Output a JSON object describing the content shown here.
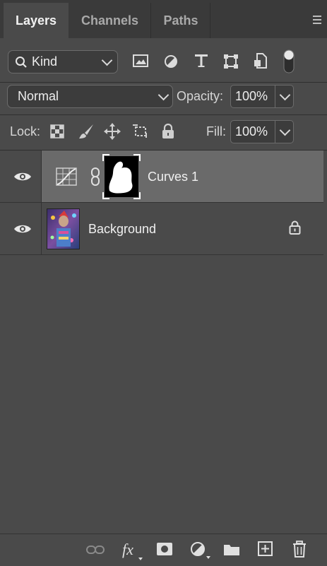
{
  "tabs": [
    {
      "label": "Layers",
      "active": true
    },
    {
      "label": "Channels",
      "active": false
    },
    {
      "label": "Paths",
      "active": false
    }
  ],
  "filter": {
    "kind_label": "Kind",
    "icons": [
      "image-filter-icon",
      "adjustment-filter-icon",
      "type-filter-icon",
      "shape-filter-icon",
      "smart-object-filter-icon",
      "filter-toggle-icon"
    ]
  },
  "blend": {
    "mode": "Normal",
    "opacity_label": "Opacity:",
    "opacity_value": "100%"
  },
  "lock": {
    "label": "Lock:",
    "fill_label": "Fill:",
    "fill_value": "100%",
    "icons": [
      "lock-transparent-icon",
      "lock-image-icon",
      "lock-position-icon",
      "lock-artboard-icon",
      "lock-all-icon"
    ]
  },
  "layers": [
    {
      "name": "Curves 1",
      "type": "adjustment",
      "visible": true,
      "selected": true
    },
    {
      "name": "Background",
      "type": "pixel",
      "visible": true,
      "locked": true,
      "selected": false
    }
  ],
  "footer_icons": [
    "link-layers-icon",
    "fx-icon",
    "add-mask-icon",
    "new-adjustment-icon",
    "new-group-icon",
    "new-layer-icon",
    "delete-layer-icon"
  ],
  "colors": {
    "panel": "#4a4a4a",
    "tabbar": "#3a3a3a",
    "selected_row": "#6a6a6a"
  }
}
